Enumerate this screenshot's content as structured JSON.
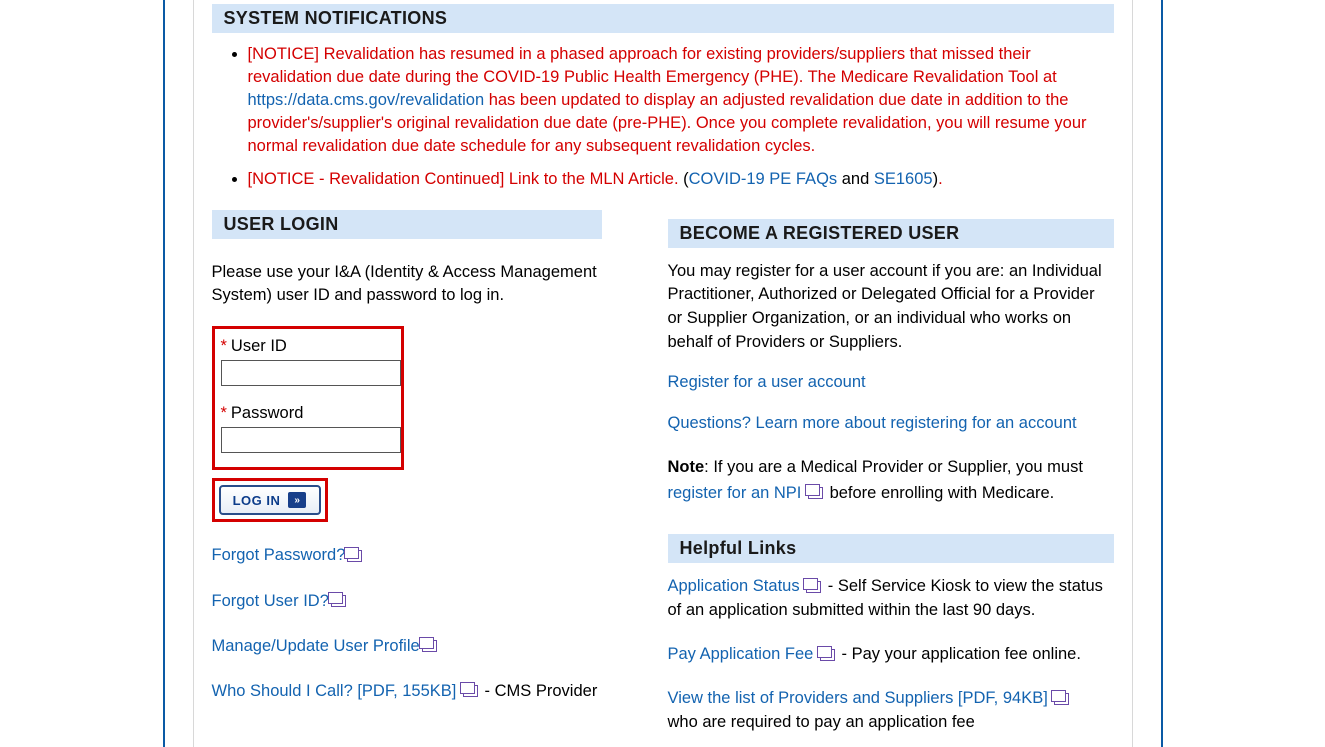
{
  "headers": {
    "notifications": "SYSTEM NOTIFICATIONS",
    "user_login": "USER LOGIN",
    "become_registered": "BECOME A REGISTERED USER",
    "helpful_links": "Helpful Links"
  },
  "notices": {
    "n1_pre": "[NOTICE] Revalidation has resumed in a phased approach for existing providers/suppliers that missed their revalidation due date during the COVID-19 Public Health Emergency (PHE). The Medicare Revalidation Tool at ",
    "n1_link": "https://data.cms.gov/revalidation",
    "n1_post": " has been updated to display an adjusted revalidation due date in addition to the provider's/supplier's original revalidation due date (pre-PHE). Once you complete revalidation, you will resume your normal revalidation due date schedule for any subsequent revalidation cycles.",
    "n2_pre": "[NOTICE - Revalidation Continued] Link to the MLN Article. ",
    "n2_paren_open": "(",
    "n2_link1": "COVID-19 PE FAQs",
    "n2_and": " and ",
    "n2_link2": "SE1605",
    "n2_paren_close": ")",
    "n2_dot": "."
  },
  "login": {
    "instructions": "Please use your I&A (Identity & Access Management System) user ID and password to log in.",
    "user_id_label": "User ID",
    "password_label": "Password",
    "button": "LOG IN",
    "forgot_password": "Forgot Password?",
    "forgot_userid": "Forgot User ID?",
    "manage_profile": "Manage/Update User Profile",
    "who_call": "Who Should I Call? [PDF, 155KB]",
    "who_call_desc": " - CMS Provider"
  },
  "register": {
    "intro": "You may register for a user account if you are: an Individual Practitioner, Authorized or Delegated Official for a Provider or Supplier Organization, or an individual who works on behalf of Providers or Suppliers.",
    "register_link": "Register for a user account",
    "questions_link": "Questions? Learn more about registering for an account",
    "note_label": "Note",
    "note_text_1": ": If you are a Medical Provider or Supplier, you must ",
    "note_link": "register for an NPI",
    "note_text_2": " before enrolling with Medicare."
  },
  "helpful": {
    "app_status": "Application Status",
    "app_status_desc": " - Self Service Kiosk to view the status of an application submitted within the last 90 days.",
    "pay_fee": "Pay Application Fee",
    "pay_fee_desc": " - Pay your application fee online.",
    "view_list": "View the list of Providers and Suppliers [PDF, 94KB]",
    "view_list_desc": " who are required to pay an application fee"
  }
}
